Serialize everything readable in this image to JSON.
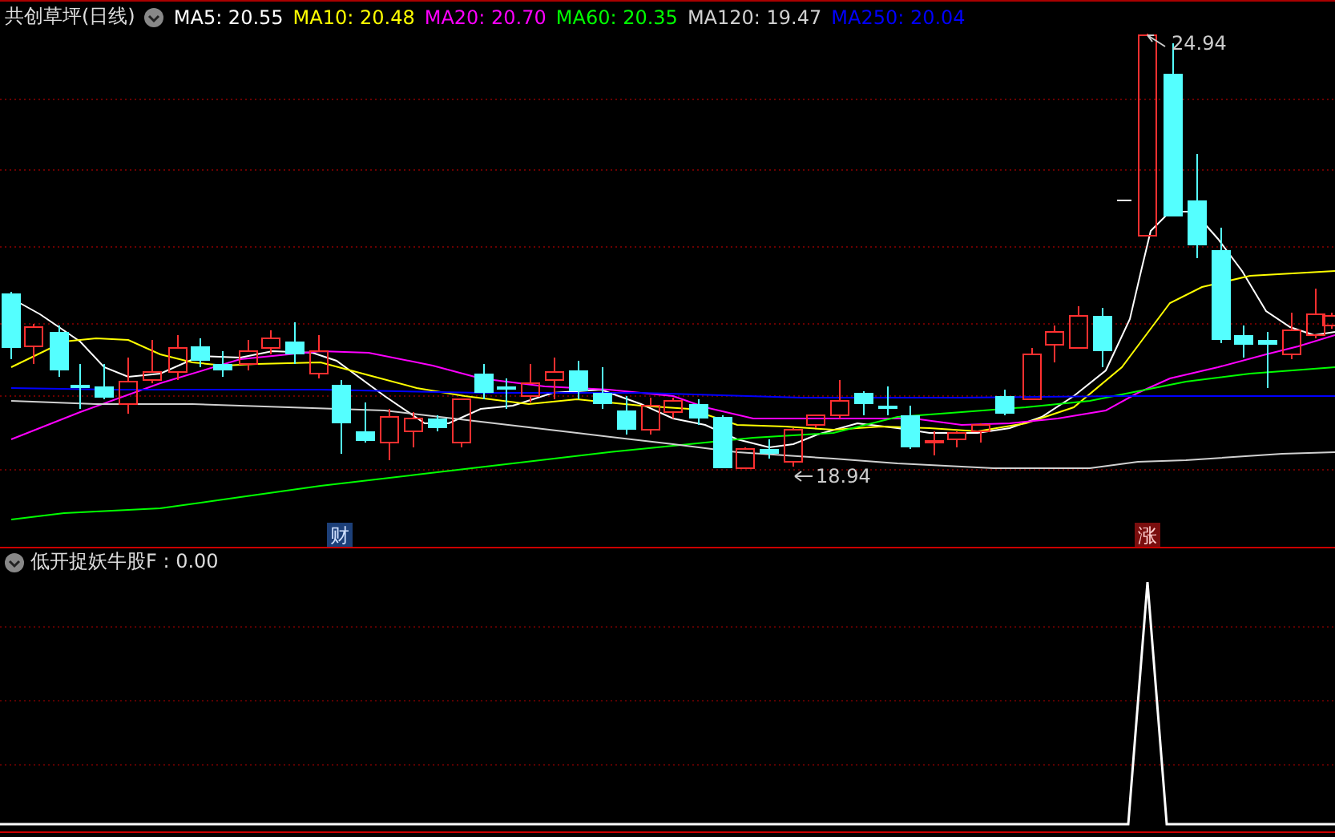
{
  "title": "共创草坪(日线)",
  "ma_legend": [
    {
      "label": "MA5: 20.55",
      "color": "#ffffff"
    },
    {
      "label": "MA10: 20.48",
      "color": "#ffff00"
    },
    {
      "label": "MA20: 20.70",
      "color": "#ff00ff"
    },
    {
      "label": "MA60: 20.35",
      "color": "#00ff00"
    },
    {
      "label": "MA120: 19.47",
      "color": "#d0d0d0"
    },
    {
      "label": "MA250: 20.04",
      "color": "#0000ff"
    }
  ],
  "high_label": "24.94",
  "low_label": "18.94",
  "markers": [
    {
      "text": "财",
      "kind": "finance"
    },
    {
      "text": "涨",
      "kind": "limit_up"
    }
  ],
  "indicator": {
    "label": "低开捉妖牛股F : 0.00"
  }
}
